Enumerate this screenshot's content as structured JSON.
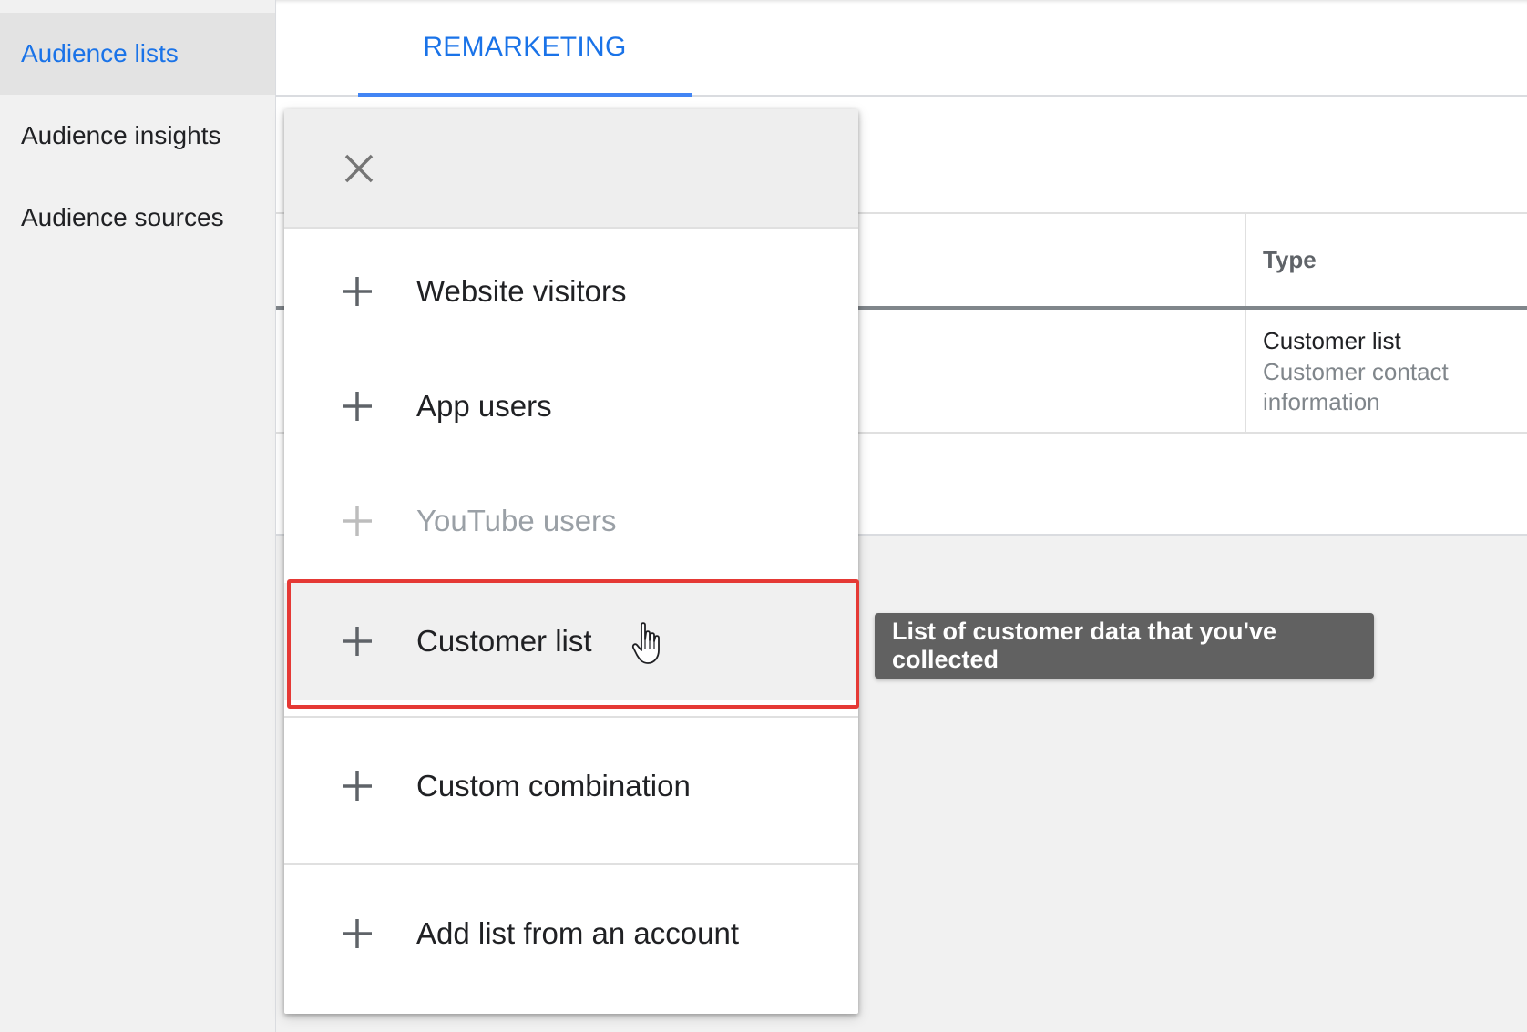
{
  "sidebar": {
    "items": [
      {
        "label": "Audience lists",
        "active": true
      },
      {
        "label": "Audience insights",
        "active": false
      },
      {
        "label": "Audience sources",
        "active": false
      }
    ]
  },
  "header": {
    "tabs": [
      {
        "label": "REMARKETING",
        "active": true
      }
    ]
  },
  "table": {
    "columns": [
      "Type"
    ],
    "rows": [
      {
        "type": "Customer list",
        "description": "Customer contact information"
      }
    ]
  },
  "menu": {
    "items": [
      {
        "label": "Website visitors",
        "disabled": false
      },
      {
        "label": "App users",
        "disabled": false
      },
      {
        "label": "YouTube users",
        "disabled": true
      },
      {
        "label": "Customer list",
        "disabled": false,
        "highlighted": true
      },
      {
        "label": "Custom combination",
        "disabled": false
      },
      {
        "label": "Add list from an account",
        "disabled": false
      }
    ]
  },
  "tooltip": {
    "text": "List of customer data that you've collected"
  },
  "colors": {
    "accent": "#1a73e8",
    "highlight_border": "#e53935",
    "tooltip_bg": "#616161"
  }
}
